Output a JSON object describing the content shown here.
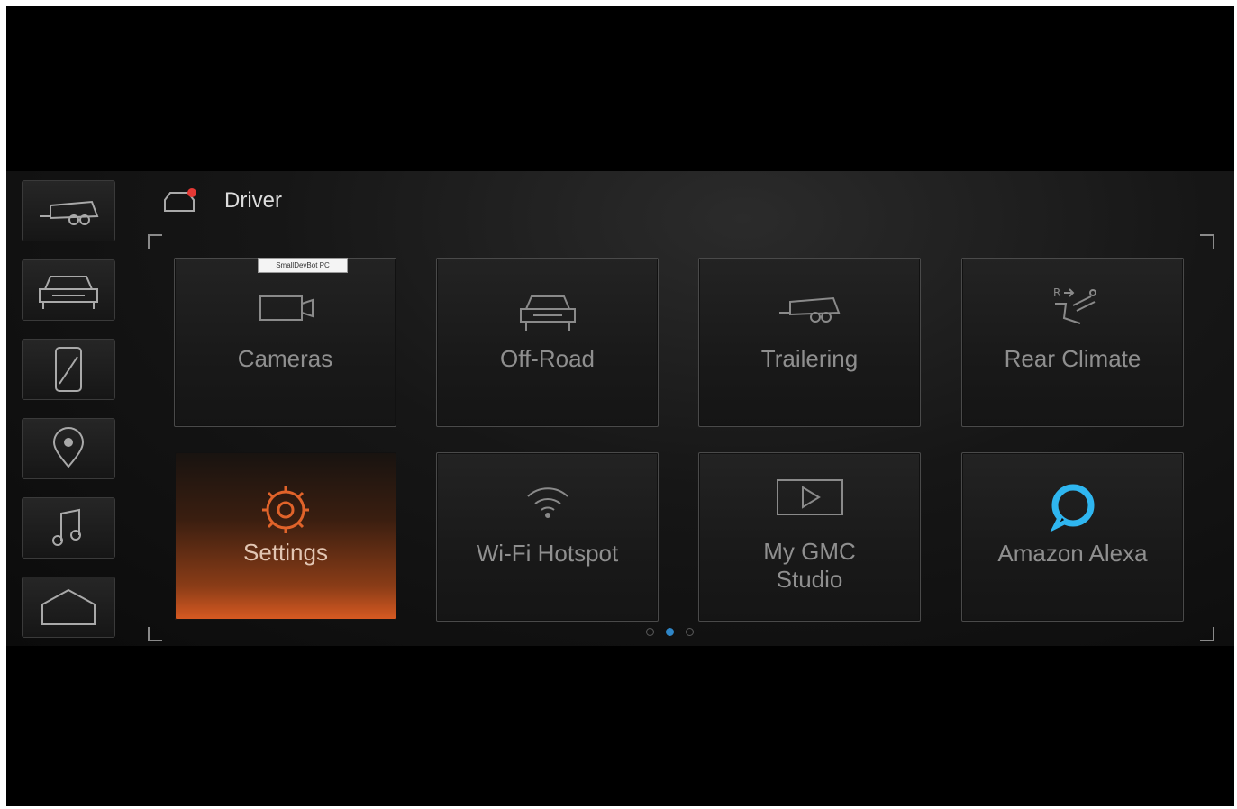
{
  "header": {
    "title": "Driver",
    "icon": "profile-notification-icon"
  },
  "tooltip": {
    "text": "SmallDevBot PC"
  },
  "sidebar": {
    "items": [
      {
        "name": "trailer",
        "icon": "trailer-icon"
      },
      {
        "name": "vehicle",
        "icon": "vehicle-front-icon"
      },
      {
        "name": "phone",
        "icon": "phone-icon"
      },
      {
        "name": "navigation",
        "icon": "location-pin-icon"
      },
      {
        "name": "audio",
        "icon": "music-note-icon"
      },
      {
        "name": "home",
        "icon": "home-icon"
      }
    ]
  },
  "tiles": [
    {
      "label": "Cameras",
      "icon": "camera-icon"
    },
    {
      "label": "Off-Road",
      "icon": "offroad-vehicle-icon"
    },
    {
      "label": "Trailering",
      "icon": "trailer-icon"
    },
    {
      "label": "Rear Climate",
      "icon": "rear-climate-icon"
    },
    {
      "label": "Settings",
      "icon": "gear-icon",
      "active": true
    },
    {
      "label": "Wi-Fi Hotspot",
      "icon": "wifi-icon"
    },
    {
      "label": "My GMC\nStudio",
      "icon": "play-box-icon"
    },
    {
      "label": "Amazon Alexa",
      "icon": "alexa-ring-icon"
    }
  ],
  "pagination": {
    "pages": 3,
    "current": 2
  },
  "colors": {
    "accent": "#d85a22",
    "alexa": "#2fb6f0",
    "page_dot": "#2f86c7",
    "notification": "#e53935"
  }
}
